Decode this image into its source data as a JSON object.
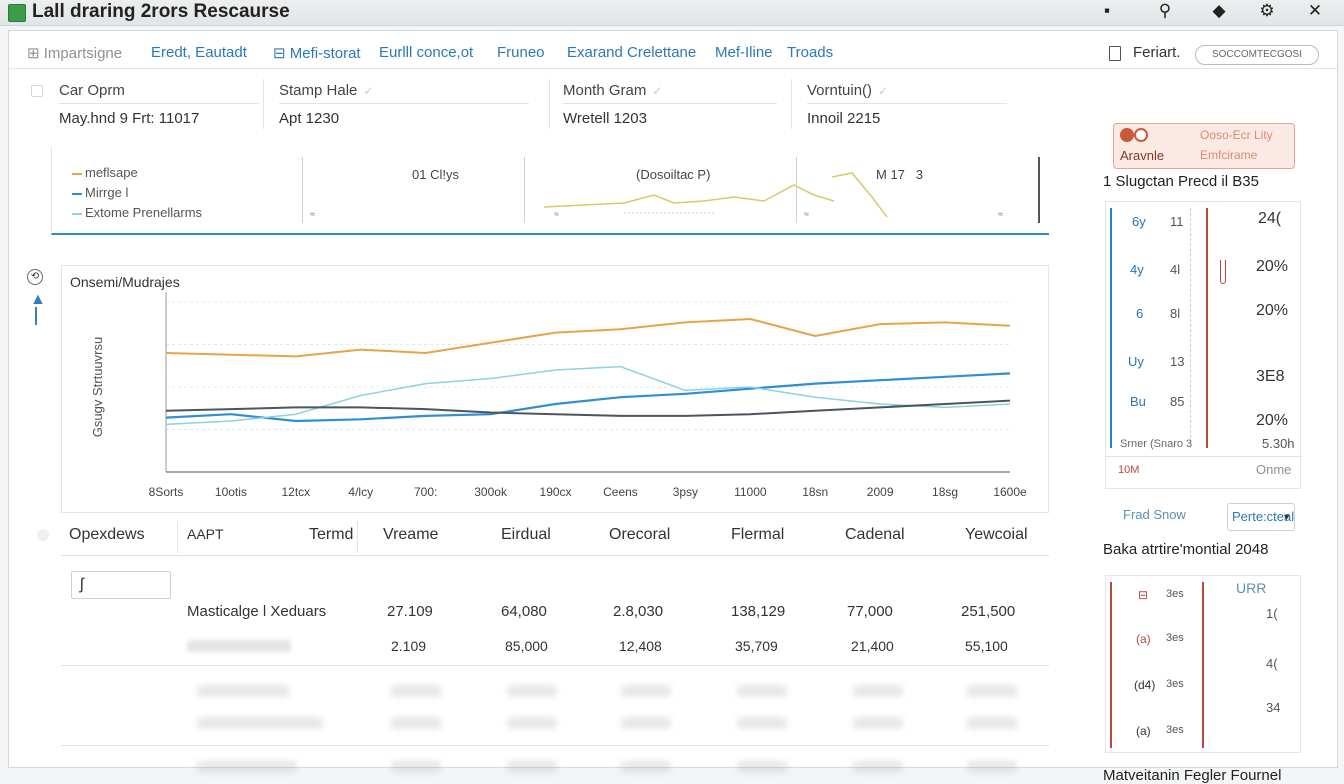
{
  "app": {
    "title": "Lall draring 2rors Rescaurse"
  },
  "toolbar": {
    "items": [
      "Impartsigne",
      "Eredt, Eautadt",
      "Mefi-storat",
      "Eurlll conce,ot",
      "Fruneo",
      "Exarand Crelettane",
      "Mef-Iline",
      "Troads"
    ],
    "right_label": "Feriart.",
    "right_pill": "SOCCOMTECGOSI"
  },
  "filters": [
    {
      "label": "Car Oprm",
      "value": "May.hnd 9 Frt: 11017"
    },
    {
      "label": "Stamp Hale",
      "value": "Apt 1230"
    },
    {
      "label": "Month Gram",
      "value": "Wretell 1203"
    },
    {
      "label": "Vorntuin()",
      "value": "Innoil 2215"
    }
  ],
  "mini_panel": {
    "legend": [
      "meflsape",
      "Mirrge l",
      "Extome Prenellarms"
    ],
    "metric_1": "01 Cl!ys",
    "metric_2": "(Dosoiltac P)",
    "metric_3": "M 17",
    "metric_3b": "3"
  },
  "main_chart": {
    "title": "Onsemi/Mudrajes",
    "ylabel": "Gsugv Strtuuvrsu",
    "x_ticks": [
      "8Sorts",
      "10otis",
      "12tcx",
      "4/lcy",
      "700:",
      "300ok",
      "190cx",
      "Ceens",
      "3psy",
      "11000",
      "18sn",
      "2009",
      "18sg",
      "1600e"
    ],
    "colors": {
      "orange": "#e8a34a",
      "blue": "#2f8fd0",
      "light_blue": "#8fd0e2",
      "dark": "#4a5560"
    }
  },
  "chart_data": {
    "type": "line",
    "title": "Onsemi/Mudrajes",
    "ylabel": "Gsugv Strtuuvrsu",
    "categories": [
      "8Sorts",
      "10otis",
      "12tcx",
      "4/lcy",
      "700:",
      "300ok",
      "190cx",
      "Ceens",
      "3psy",
      "11000",
      "18sn",
      "2009",
      "18sg",
      "1600e"
    ],
    "ylim": [
      0,
      100
    ],
    "series": [
      {
        "values": [
          70,
          69,
          68,
          72,
          70,
          76,
          82,
          84,
          88,
          90,
          80,
          87,
          88,
          86
        ]
      },
      {
        "values": [
          32,
          34,
          30,
          31,
          33,
          34,
          40,
          44,
          46,
          49,
          52,
          54,
          56,
          58
        ]
      },
      {
        "values": [
          28,
          30,
          34,
          45,
          52,
          55,
          60,
          62,
          48,
          50,
          44,
          40,
          38,
          40
        ]
      },
      {
        "values": [
          36,
          37,
          38,
          38,
          37,
          35,
          34,
          33,
          33,
          34,
          36,
          38,
          40,
          42
        ]
      }
    ]
  },
  "table": {
    "headers": [
      "Opexdews",
      "AAPT",
      "Termd",
      "Vreame",
      "Eirdual",
      "Orecoral",
      "Flermal",
      "Cadenal",
      "Yewcoial"
    ],
    "rows": [
      {
        "name": "Masticalge l Xeduars",
        "cols": [
          "27.109",
          "64,080",
          "2.8,030",
          "138,129",
          "77,000",
          "251,500"
        ]
      },
      {
        "name": "",
        "cols": [
          "2.109",
          "85,000",
          "12,408",
          "35,709",
          "21,400",
          "55,100"
        ]
      }
    ]
  },
  "right_panel": {
    "callout_1": "Ooso-Ecr Lity",
    "callout_2": "Emfcirame",
    "callout_3": "Aravnle",
    "section_title": "1 Slugctan Precd il B35",
    "rows": [
      {
        "label": "6y",
        "num": "11",
        "pct": "24("
      },
      {
        "label": "4y",
        "num": "4l",
        "pct": "20%"
      },
      {
        "label": "6",
        "num": "8l",
        "pct": "20%"
      },
      {
        "label": "Uy",
        "num": "13",
        "pct": "3E8"
      },
      {
        "label": "Bu",
        "num": "85",
        "pct": "20%"
      }
    ],
    "footer_left": "Srner (Snaro 3",
    "footer_right": "5.30h",
    "bottom_left": "10M",
    "bottom_right": "Onme",
    "link_label": "Frad Snow",
    "dropdown_label": "Perte:cteal",
    "section2_title": "Baka atrtire'montial 2048",
    "s2_header": "URR",
    "s2_rows": [
      {
        "label": "3es",
        "num": "1("
      },
      {
        "label": "3es",
        "num": "4("
      },
      {
        "label": "3es",
        "num": "34"
      },
      {
        "label": "3es",
        "num": ""
      }
    ],
    "footer_title": "Matveitanin Fegler Fournel"
  }
}
